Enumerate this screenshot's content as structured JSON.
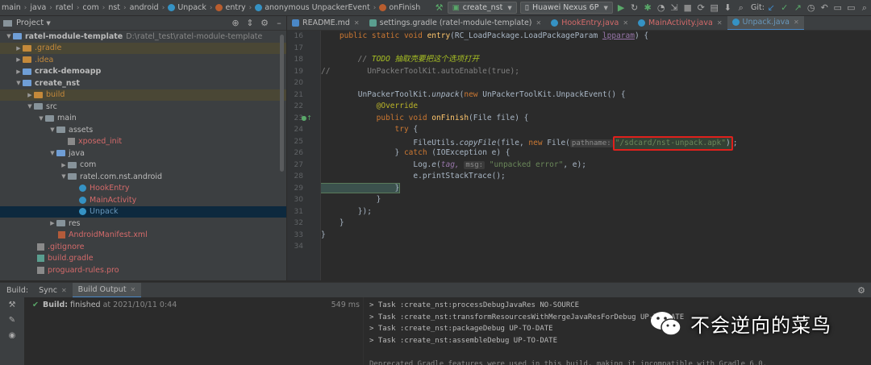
{
  "navbar": {
    "crumbs": [
      "main",
      "java",
      "ratel",
      "com",
      "nst",
      "android",
      "Unpack",
      "entry",
      "anonymous UnpackerEvent",
      "onFinish"
    ],
    "run_config": "create_nst",
    "device": "Huawei Nexus 6P",
    "git_label": "Git:"
  },
  "project": {
    "title": "Project",
    "tree": [
      {
        "label": "ratel-module-template",
        "path": "D:\\ratel_test\\ratel-module-template"
      },
      {
        "label": ".gradle"
      },
      {
        "label": ".idea"
      },
      {
        "label": "crack-demoapp"
      },
      {
        "label": "create_nst"
      },
      {
        "label": "build"
      },
      {
        "label": "src"
      },
      {
        "label": "main"
      },
      {
        "label": "assets"
      },
      {
        "label": "xposed_init"
      },
      {
        "label": "java"
      },
      {
        "label": "com"
      },
      {
        "label": "ratel.com.nst.android"
      },
      {
        "label": "HookEntry"
      },
      {
        "label": "MainActivity"
      },
      {
        "label": "Unpack"
      },
      {
        "label": "res"
      },
      {
        "label": "AndroidManifest.xml"
      },
      {
        "label": ".gitignore"
      },
      {
        "label": "build.gradle"
      },
      {
        "label": "proguard-rules.pro"
      }
    ]
  },
  "tabs": [
    {
      "label": "README.md"
    },
    {
      "label": "settings.gradle (ratel-module-template)"
    },
    {
      "label": "HookEntry.java"
    },
    {
      "label": "MainActivity.java"
    },
    {
      "label": "Unpack.java"
    }
  ],
  "editor": {
    "line_numbers": [
      "16",
      "17",
      "18",
      "19",
      "20",
      "21",
      "22",
      "23",
      "24",
      "25",
      "26",
      "27",
      "28",
      "29",
      "30",
      "31",
      "32",
      "33",
      "34"
    ],
    "l16": {
      "a": "    public static void ",
      "b": "entry",
      "c": "(RC_LoadPackage.LoadPackageParam ",
      "d": "lpparam",
      "e": ") {"
    },
    "l18": {
      "a": "        // ",
      "b": "TODO 抽取壳要把这个选项打开"
    },
    "l19": {
      "a": "//        UnPackerToolKit.autoEnable(true);"
    },
    "l21": {
      "a": "        UnPackerToolKit.",
      "b": "unpack",
      "c": "(",
      "d": "new",
      "e": " UnPackerToolKit.UnpackEvent() {"
    },
    "l22": {
      "a": "            @Override"
    },
    "l23": {
      "a": "            public void ",
      "b": "onFinish",
      "c": "(File file) {"
    },
    "l24": {
      "a": "                try",
      "b": " {"
    },
    "l25": {
      "a": "                    FileUtils.",
      "b": "copyFile",
      "c": "(file, ",
      "d": "new",
      "e": " File(",
      "hint": "pathname:",
      "f": "\"/sdcard/nst-unpack.apk\"",
      "g": ");"
    },
    "l26": {
      "a": "                } ",
      "b": "catch",
      "c": " (IOException e) {"
    },
    "l27": {
      "a": "                    Log.",
      "b": "e",
      "c": "(",
      "d": "tag,",
      "hint": "msg:",
      "f": "\"unpacked error\"",
      "g": ", e);"
    },
    "l28": {
      "a": "                    e.printStackTrace();"
    },
    "l29": {
      "a": "                }"
    },
    "l30": {
      "a": "            }"
    },
    "l31": {
      "a": "        });"
    },
    "l32": {
      "a": "    }"
    },
    "l33": {
      "a": "}"
    }
  },
  "bottom": {
    "panel_label": "Build:",
    "tabs": [
      "Sync",
      "Build Output"
    ],
    "build_status_label": "Build:",
    "build_status": "finished",
    "build_time": "at 2021/10/11 0:44",
    "duration": "549 ms",
    "output": [
      "> Task :create_nst:processDebugJavaRes NO-SOURCE",
      "> Task :create_nst:transformResourcesWithMergeJavaResForDebug UP-TO-DATE",
      "> Task :create_nst:packageDebug UP-TO-DATE",
      "> Task :create_nst:assembleDebug UP-TO-DATE",
      "",
      "Deprecated Gradle features were used in this build, making it incompatible with Gradle 6.0."
    ]
  },
  "watermark": {
    "text": "不会逆向的菜鸟"
  },
  "colors": {
    "accent": "#4a88c7",
    "highlight_box": "#e0201c",
    "selection": "#0d293e"
  }
}
